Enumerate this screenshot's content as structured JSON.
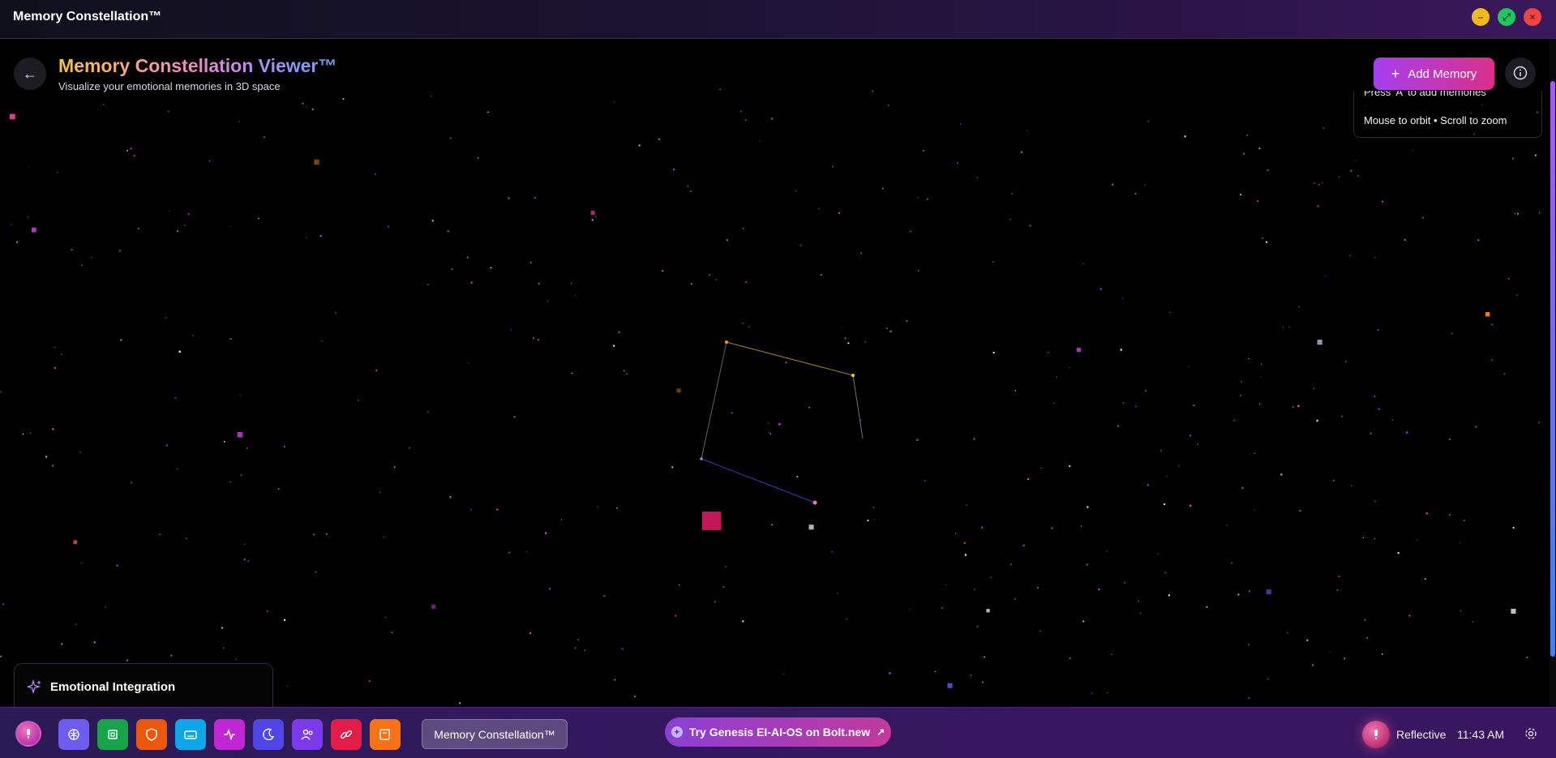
{
  "window": {
    "title": "Memory Constellation™"
  },
  "viewer": {
    "title": "Memory Constellation Viewer™",
    "subtitle": "Visualize your emotional memories in 3D space",
    "add_button": "Add Memory",
    "help": {
      "line1": "Press 'A' to add memories",
      "line2": "Mouse to orbit • Scroll to zoom"
    }
  },
  "emotion_panel": {
    "title": "Emotional Integration"
  },
  "taskbar": {
    "apps": [
      {
        "name": "brain-icon",
        "color": "#6d5cf0"
      },
      {
        "name": "cpu-icon",
        "color": "#16a34a"
      },
      {
        "name": "shield-icon",
        "color": "#ea580c"
      },
      {
        "name": "keyboard-icon",
        "color": "#0ea5e9"
      },
      {
        "name": "activity-icon",
        "color": "#c026d3"
      },
      {
        "name": "moon-icon",
        "color": "#4f46e5"
      },
      {
        "name": "users-icon",
        "color": "#7c3aed"
      },
      {
        "name": "link-icon",
        "color": "#e11d48"
      },
      {
        "name": "scroll-icon",
        "color": "#f97316"
      }
    ],
    "active_window": "Memory Constellation™",
    "bolt_link": "Try Genesis EI-AI-OS on Bolt.new",
    "mood": "Reflective",
    "time": "11:43 AM"
  },
  "colors": {
    "accent_purple": "#a63ef0",
    "accent_pink": "#db2f8a",
    "memory_node": "#c2185b"
  }
}
